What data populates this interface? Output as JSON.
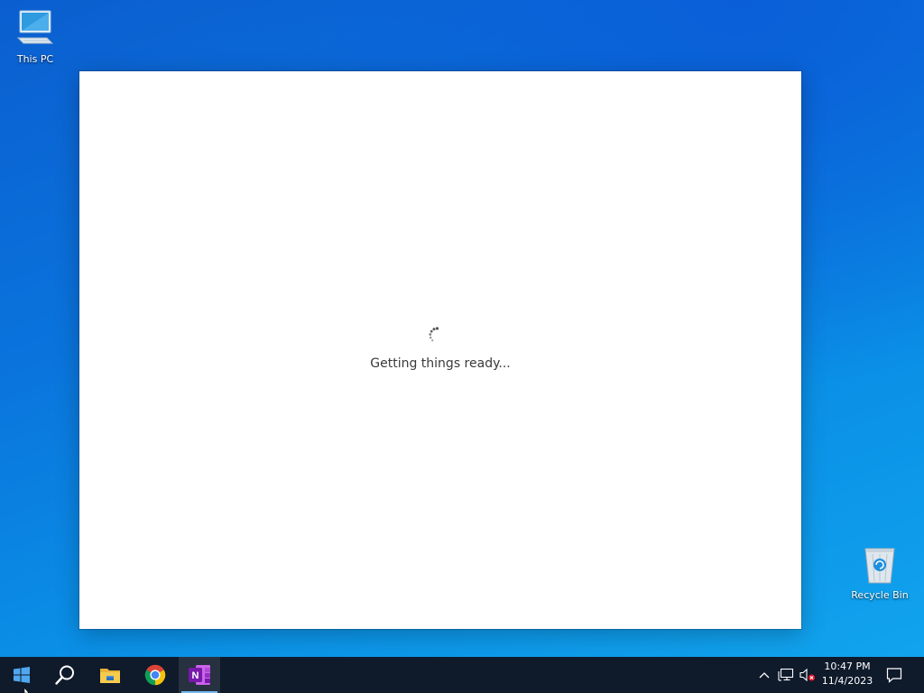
{
  "desktop": {
    "icons": [
      {
        "label": "This PC"
      },
      {
        "label": "Recycle Bin"
      }
    ]
  },
  "dialog": {
    "loading_text": "Getting things ready..."
  },
  "taskbar": {
    "apps": [
      {
        "icon": "windows-start-icon"
      },
      {
        "icon": "search-icon"
      },
      {
        "icon": "file-explorer-icon"
      },
      {
        "icon": "chrome-icon"
      },
      {
        "icon": "onenote-icon",
        "active": true
      }
    ],
    "tray": {
      "time": "10:47 PM",
      "date": "11/4/2023"
    }
  },
  "colors": {
    "taskbar_bg": "#0f1a2b",
    "active_indicator": "#76b9ed",
    "onenote_purple": "#7719aa"
  }
}
